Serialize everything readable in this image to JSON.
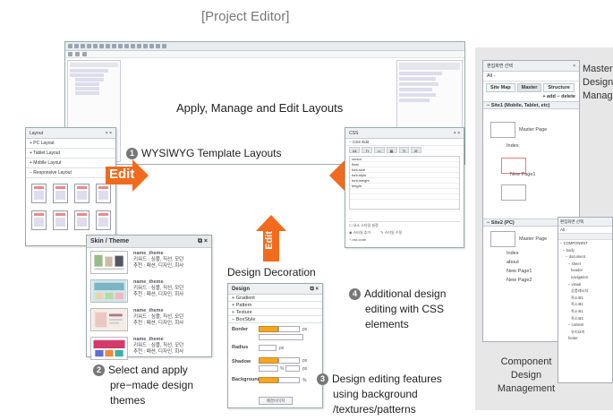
{
  "title": "[Project Editor]",
  "editor": {
    "apply_text": "Apply, Manage and Edit Layouts"
  },
  "layout_panel": {
    "title": "Layout",
    "items": [
      "+ PC Layout",
      "+ Tablet Layout",
      "+ Mobile Layout",
      "− Responsive Layout"
    ]
  },
  "step1": {
    "num": "1",
    "text": "WYSIWYG Template Layouts"
  },
  "edit_label": "Edit",
  "skin_panel": {
    "title": "Skin / Theme",
    "themes": [
      {
        "name": "name_theme",
        "kw": "키워드 : 심플, 직선, 모던",
        "rec": "추천 : 패션, 디자인, 회사"
      },
      {
        "name": "name_theme",
        "kw": "키워드 : 심플, 직선, 모던",
        "rec": "추천 : 패션, 디자인, 회사"
      },
      {
        "name": "name_theme",
        "kw": "키워드 : 심플, 직선, 모던",
        "rec": "추천 : 패션, 디자인, 회사"
      },
      {
        "name": "name_theme",
        "kw": "키워드 : 심플, 직선, 모던",
        "rec": "추천 : 패션, 디자인, 회사"
      }
    ]
  },
  "step2": {
    "num": "2",
    "line1": "Select and apply",
    "line2": "pre−made design",
    "line3": "themes"
  },
  "css_panel": {
    "title": "CSS",
    "section": "− CSS Edit"
  },
  "step4": {
    "num": "4",
    "line1": "Additional design",
    "line2": "editing with CSS",
    "line3": "elements"
  },
  "design_decoration": "Design Decoration",
  "design_panel": {
    "title": "Design",
    "sections": [
      "+ Gradient",
      "+ Pattern",
      "+ Texture",
      "− BoxStyle"
    ],
    "border_label": "Border",
    "radius_label": "Radius",
    "shadow_label": "Shadow",
    "background_label": "Background",
    "unit_px": "px",
    "unit_pct": "%",
    "bg_button": "배경이미지"
  },
  "step3": {
    "num": "3",
    "line1": "Design editing features",
    "line2": "using background",
    "line3": "/textures/patterns"
  },
  "site_panel": {
    "title": "편집화면 선택",
    "dropdown": "All -",
    "tabs": [
      "Site Map",
      "Master",
      "Structure"
    ],
    "actions": "+ add  − delete",
    "site1": "− Site1 (Mobile, Tablet, etc)",
    "site2": "− Site2 (PC)",
    "master_page": "Master Page",
    "index": "Index",
    "new_page": "New Page1",
    "about": "about",
    "new_page1": "New Page1",
    "new_page2": "New Page2"
  },
  "master_text": {
    "line1": "Master",
    "line2": "Design",
    "line3": "Manage"
  },
  "component_text": {
    "line1": "Component",
    "line2": "Design",
    "line3": "Management"
  },
  "comp_panel": {
    "title": "편집화면 선택",
    "dropdown": "All -",
    "tree": [
      "− COMPONENT",
      "  − body",
      "    − document",
      "      − sheet",
      "        header",
      "        navigation",
      "      − visual",
      "        상품레시지",
      "        족소표1",
      "        족소표1",
      "        족소표1",
      "        족소표1",
      "      − content",
      "        유리요미",
      "      footer"
    ]
  }
}
